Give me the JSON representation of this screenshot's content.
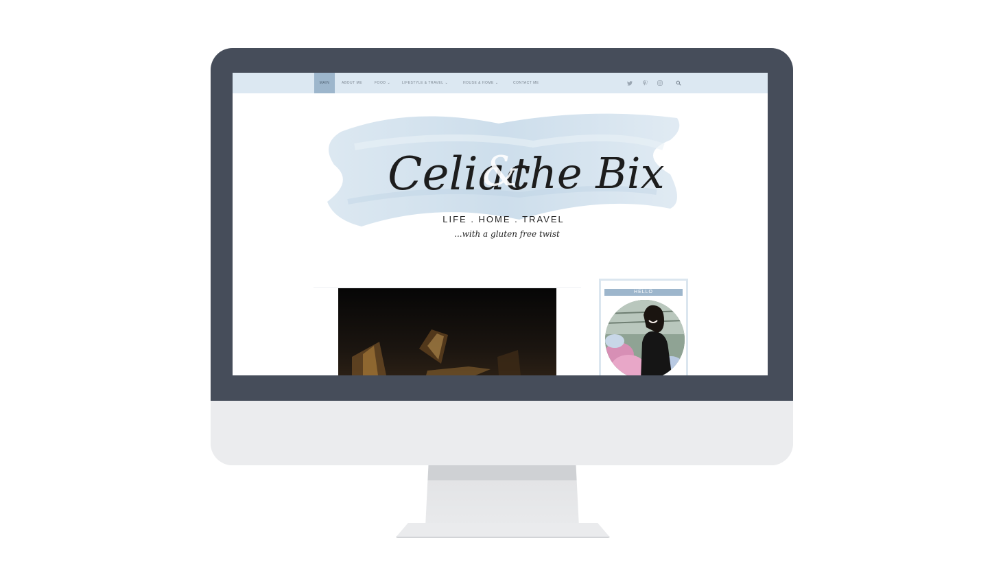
{
  "nav": {
    "items": [
      {
        "label": "MAIN",
        "active": true
      },
      {
        "label": "ABOUT ME",
        "active": false
      },
      {
        "label": "FOOD",
        "active": false,
        "dropdown": true
      },
      {
        "label": "LIFESTYLE & TRAVEL",
        "active": false,
        "dropdown": true
      },
      {
        "label": "HOUSE & HOME",
        "active": false,
        "dropdown": true
      },
      {
        "label": "CONTACT ME",
        "active": false
      }
    ],
    "social_icons": [
      "twitter-icon",
      "pinterest-icon",
      "instagram-icon"
    ],
    "search_icon": "search-icon"
  },
  "header": {
    "logo_text": "Celiac & the Bix",
    "tagline": "LIFE . HOME . TRAVEL",
    "subtagline": "...with a gluten free twist"
  },
  "sidebar": {
    "title": "HELLO"
  },
  "colors": {
    "bezel": "#464d5a",
    "nav_bg": "#dce8f2",
    "nav_active": "#9db6cc",
    "accent": "#9db6cc",
    "brush": "#c9dbe9"
  }
}
